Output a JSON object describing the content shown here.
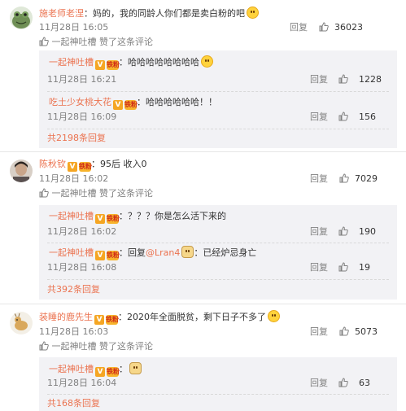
{
  "comments": [
    {
      "author": "施老师老涅",
      "text": "：妈的，我的同龄人你们都是卖白粉的吧",
      "time": "11月28日 16:05",
      "reply_label": "回复",
      "likes": "36023",
      "liked_by": "一起神吐槽 赞了这条评论",
      "replies": [
        {
          "author": "一起神吐槽",
          "text": "：哈哈哈哈哈哈哈哈",
          "time": "11月28日 16:21",
          "reply_label": "回复",
          "likes": "1228"
        },
        {
          "author": "吃土少女桃大花",
          "text": "：哈哈哈哈哈哈！！",
          "time": "11月28日 16:09",
          "reply_label": "回复",
          "likes": "156"
        }
      ],
      "more": "共2198条回复"
    },
    {
      "author": "陈秋钦",
      "text": "：95后 收入0",
      "time": "11月28日 16:02",
      "reply_label": "回复",
      "likes": "7029",
      "liked_by": "一起神吐槽 赞了这条评论",
      "replies": [
        {
          "author": "一起神吐槽",
          "text": "：？？？你是怎么活下来的",
          "time": "11月28日 16:02",
          "reply_label": "回复",
          "likes": "190"
        },
        {
          "author": "一起神吐槽",
          "text_prefix": "：回复",
          "mention": "@Lran4",
          "text_suffix": "：已经炉忌身亡",
          "time": "11月28日 16:08",
          "reply_label": "回复",
          "likes": "19"
        }
      ],
      "more": "共392条回复"
    },
    {
      "author": "装睡的鹿先生",
      "text": "：2020年全面脱贫，剩下日子不多了",
      "time": "11月28日 16:03",
      "reply_label": "回复",
      "likes": "5073",
      "liked_by": "一起神吐槽 赞了这条评论",
      "replies": [
        {
          "author": "一起神吐槽",
          "text": "：",
          "time": "11月28日 16:04",
          "reply_label": "回复",
          "likes": "63"
        }
      ],
      "more": "共168条回复"
    }
  ],
  "badges": {
    "verified": "V",
    "fan": "铁粉"
  },
  "colors": {
    "name": "#eb7350",
    "muted": "#808080",
    "subbox": "#f2f2f5"
  }
}
